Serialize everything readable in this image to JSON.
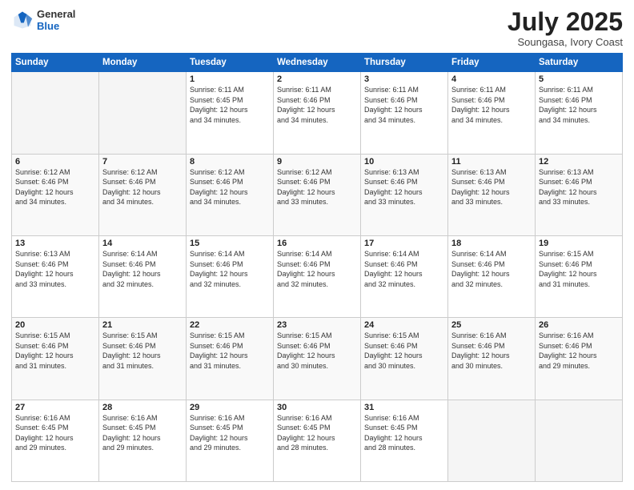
{
  "logo": {
    "general": "General",
    "blue": "Blue"
  },
  "header": {
    "month": "July 2025",
    "location": "Soungasa, Ivory Coast"
  },
  "weekdays": [
    "Sunday",
    "Monday",
    "Tuesday",
    "Wednesday",
    "Thursday",
    "Friday",
    "Saturday"
  ],
  "weeks": [
    [
      {
        "day": "",
        "info": ""
      },
      {
        "day": "",
        "info": ""
      },
      {
        "day": "1",
        "info": "Sunrise: 6:11 AM\nSunset: 6:45 PM\nDaylight: 12 hours\nand 34 minutes."
      },
      {
        "day": "2",
        "info": "Sunrise: 6:11 AM\nSunset: 6:46 PM\nDaylight: 12 hours\nand 34 minutes."
      },
      {
        "day": "3",
        "info": "Sunrise: 6:11 AM\nSunset: 6:46 PM\nDaylight: 12 hours\nand 34 minutes."
      },
      {
        "day": "4",
        "info": "Sunrise: 6:11 AM\nSunset: 6:46 PM\nDaylight: 12 hours\nand 34 minutes."
      },
      {
        "day": "5",
        "info": "Sunrise: 6:11 AM\nSunset: 6:46 PM\nDaylight: 12 hours\nand 34 minutes."
      }
    ],
    [
      {
        "day": "6",
        "info": "Sunrise: 6:12 AM\nSunset: 6:46 PM\nDaylight: 12 hours\nand 34 minutes."
      },
      {
        "day": "7",
        "info": "Sunrise: 6:12 AM\nSunset: 6:46 PM\nDaylight: 12 hours\nand 34 minutes."
      },
      {
        "day": "8",
        "info": "Sunrise: 6:12 AM\nSunset: 6:46 PM\nDaylight: 12 hours\nand 34 minutes."
      },
      {
        "day": "9",
        "info": "Sunrise: 6:12 AM\nSunset: 6:46 PM\nDaylight: 12 hours\nand 33 minutes."
      },
      {
        "day": "10",
        "info": "Sunrise: 6:13 AM\nSunset: 6:46 PM\nDaylight: 12 hours\nand 33 minutes."
      },
      {
        "day": "11",
        "info": "Sunrise: 6:13 AM\nSunset: 6:46 PM\nDaylight: 12 hours\nand 33 minutes."
      },
      {
        "day": "12",
        "info": "Sunrise: 6:13 AM\nSunset: 6:46 PM\nDaylight: 12 hours\nand 33 minutes."
      }
    ],
    [
      {
        "day": "13",
        "info": "Sunrise: 6:13 AM\nSunset: 6:46 PM\nDaylight: 12 hours\nand 33 minutes."
      },
      {
        "day": "14",
        "info": "Sunrise: 6:14 AM\nSunset: 6:46 PM\nDaylight: 12 hours\nand 32 minutes."
      },
      {
        "day": "15",
        "info": "Sunrise: 6:14 AM\nSunset: 6:46 PM\nDaylight: 12 hours\nand 32 minutes."
      },
      {
        "day": "16",
        "info": "Sunrise: 6:14 AM\nSunset: 6:46 PM\nDaylight: 12 hours\nand 32 minutes."
      },
      {
        "day": "17",
        "info": "Sunrise: 6:14 AM\nSunset: 6:46 PM\nDaylight: 12 hours\nand 32 minutes."
      },
      {
        "day": "18",
        "info": "Sunrise: 6:14 AM\nSunset: 6:46 PM\nDaylight: 12 hours\nand 32 minutes."
      },
      {
        "day": "19",
        "info": "Sunrise: 6:15 AM\nSunset: 6:46 PM\nDaylight: 12 hours\nand 31 minutes."
      }
    ],
    [
      {
        "day": "20",
        "info": "Sunrise: 6:15 AM\nSunset: 6:46 PM\nDaylight: 12 hours\nand 31 minutes."
      },
      {
        "day": "21",
        "info": "Sunrise: 6:15 AM\nSunset: 6:46 PM\nDaylight: 12 hours\nand 31 minutes."
      },
      {
        "day": "22",
        "info": "Sunrise: 6:15 AM\nSunset: 6:46 PM\nDaylight: 12 hours\nand 31 minutes."
      },
      {
        "day": "23",
        "info": "Sunrise: 6:15 AM\nSunset: 6:46 PM\nDaylight: 12 hours\nand 30 minutes."
      },
      {
        "day": "24",
        "info": "Sunrise: 6:15 AM\nSunset: 6:46 PM\nDaylight: 12 hours\nand 30 minutes."
      },
      {
        "day": "25",
        "info": "Sunrise: 6:16 AM\nSunset: 6:46 PM\nDaylight: 12 hours\nand 30 minutes."
      },
      {
        "day": "26",
        "info": "Sunrise: 6:16 AM\nSunset: 6:46 PM\nDaylight: 12 hours\nand 29 minutes."
      }
    ],
    [
      {
        "day": "27",
        "info": "Sunrise: 6:16 AM\nSunset: 6:45 PM\nDaylight: 12 hours\nand 29 minutes."
      },
      {
        "day": "28",
        "info": "Sunrise: 6:16 AM\nSunset: 6:45 PM\nDaylight: 12 hours\nand 29 minutes."
      },
      {
        "day": "29",
        "info": "Sunrise: 6:16 AM\nSunset: 6:45 PM\nDaylight: 12 hours\nand 29 minutes."
      },
      {
        "day": "30",
        "info": "Sunrise: 6:16 AM\nSunset: 6:45 PM\nDaylight: 12 hours\nand 28 minutes."
      },
      {
        "day": "31",
        "info": "Sunrise: 6:16 AM\nSunset: 6:45 PM\nDaylight: 12 hours\nand 28 minutes."
      },
      {
        "day": "",
        "info": ""
      },
      {
        "day": "",
        "info": ""
      }
    ]
  ]
}
